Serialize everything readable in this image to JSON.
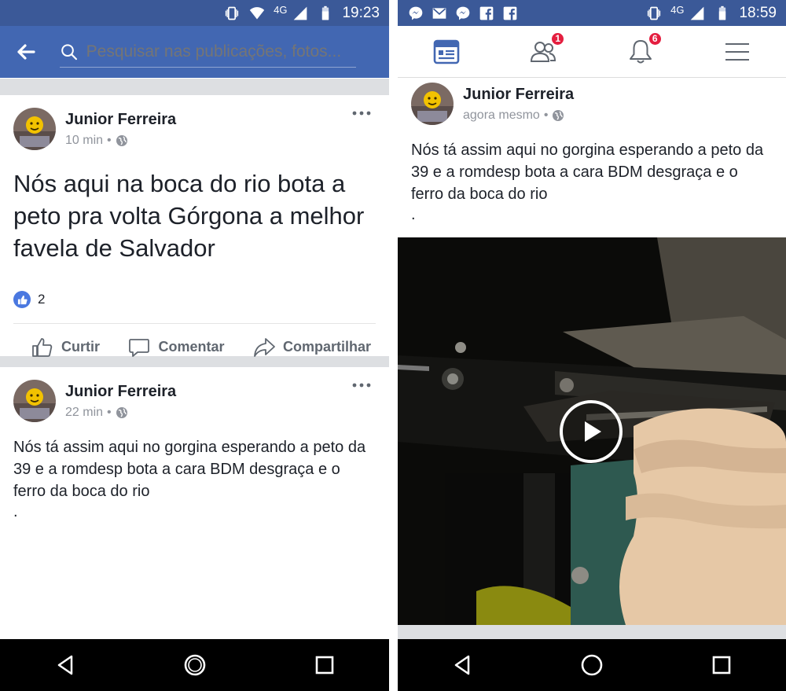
{
  "left": {
    "status": {
      "network": "4G",
      "time": "19:23"
    },
    "search": {
      "placeholder": "Pesquisar nas publicações, fotos..."
    },
    "posts": [
      {
        "author": "Junior Ferreira",
        "time": "10 min",
        "text": "Nós aqui na boca do rio bota a peto pra volta Górgona a melhor favela de Salvador",
        "likes": "2",
        "actions": {
          "like": "Curtir",
          "comment": "Comentar",
          "share": "Compartilhar"
        }
      },
      {
        "author": "Junior Ferreira",
        "time": "22 min",
        "text": "Nós tá assim aqui no gorgina esperando a peto da 39 e a romdesp bota a cara BDM desgraça e o ferro da boca do rio",
        "trailing": "."
      }
    ]
  },
  "right": {
    "status": {
      "network": "4G",
      "time": "18:59"
    },
    "tabs": {
      "friends_badge": "1",
      "notifications_badge": "6"
    },
    "post": {
      "author": "Junior Ferreira",
      "time": "agora mesmo",
      "text": "Nós tá assim aqui no gorgina esperando a peto da 39 e a romdesp bota a cara BDM desgraça e o ferro da boca do rio",
      "trailing": "."
    }
  },
  "colors": {
    "fb_blue": "#4267b2",
    "status_blue": "#3b5998",
    "badge_red": "#e41e3f",
    "like_blue": "#4a78e0"
  }
}
